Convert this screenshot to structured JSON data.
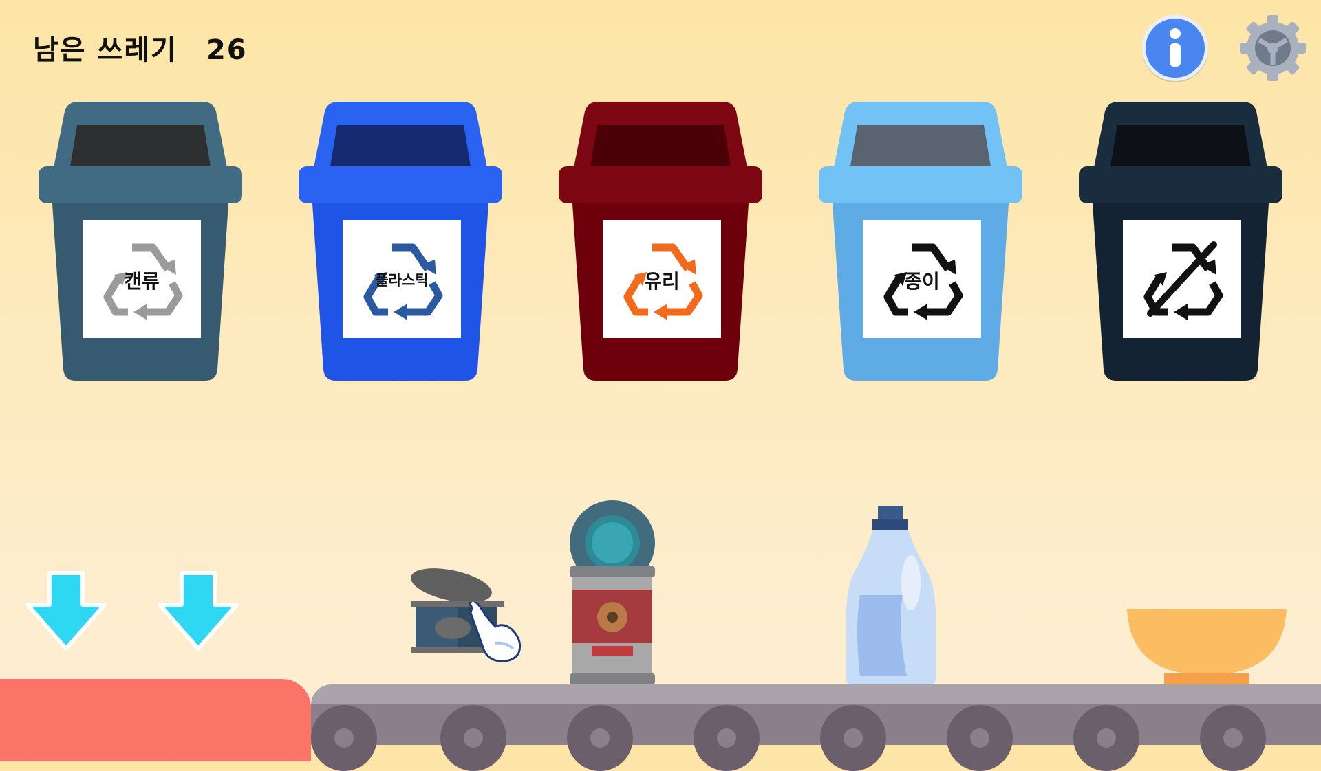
{
  "hud": {
    "remaining_label": "남은 쓰레기",
    "remaining_count": "26"
  },
  "top_buttons": {
    "info_icon": "info-icon",
    "settings_icon": "gear-icon"
  },
  "bins": [
    {
      "label": "캔류",
      "color": "#365a70",
      "symbol_color": "#9b9b9b",
      "lid_color": "#416b82"
    },
    {
      "label": "플라스틱",
      "color": "#1e55e6",
      "symbol_color": "#2c5aa0",
      "lid_color": "#2a63f2"
    },
    {
      "label": "유리",
      "color": "#6e000c",
      "symbol_color": "#f26a1b",
      "lid_color": "#7c0612"
    },
    {
      "label": "종이",
      "color": "#5eabe6",
      "symbol_color": "#111111",
      "lid_color": "#73c2f5"
    },
    {
      "label": "",
      "color": "#142333",
      "symbol_color": "#111111",
      "lid_color": "#1a2d3f",
      "symbol": "no-recycle-icon"
    }
  ],
  "controls": {
    "left_arrow_icon": "down-arrow-icon",
    "right_arrow_icon": "down-arrow-icon",
    "arrow_color": "#2ed8f2"
  },
  "conveyor_items": [
    "open-tuna-can",
    "pointing-hand-cursor",
    "food-can",
    "plastic-detergent-bottle",
    "orange-bowl"
  ],
  "colors": {
    "background": "#fde8b0",
    "conveyor": "#8a7f8a",
    "left_block": "#fb7467"
  }
}
